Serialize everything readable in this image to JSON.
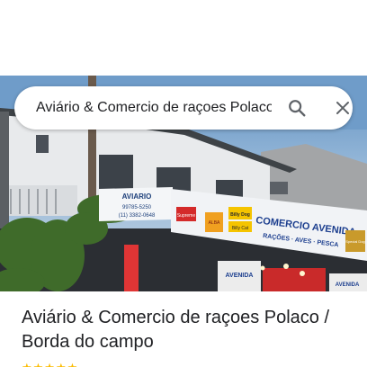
{
  "search": {
    "query": "Aviário & Comercio de raçoes Polaco / Borda do campo",
    "search_icon": "search-icon",
    "close_icon": "close-icon"
  },
  "place": {
    "title": "Aviário & Comercio de raçoes Polaco / Borda do campo",
    "stars": "★★★★★"
  },
  "photo": {
    "sign_left_name": "AVIARIO",
    "sign_left_phone1": "99785-5250",
    "sign_left_phone2": "(11) 3382-0648",
    "sign_main_title": "COMERCIO AVENIDA",
    "sign_main_sub": "RAÇÕES · AVES · PESCA",
    "brand_1": "Supreme",
    "brand_2": "Billy Dog",
    "brand_3": "Billy Cat",
    "brand_4": "ALBA",
    "brand_5": "Special Dog",
    "lower_sign_1": "AVENIDA",
    "lower_sign_2": "AVENIDA"
  },
  "colors": {
    "accent_icon": "#5f6368",
    "title_text": "#202124",
    "star": "#fbbc04"
  }
}
